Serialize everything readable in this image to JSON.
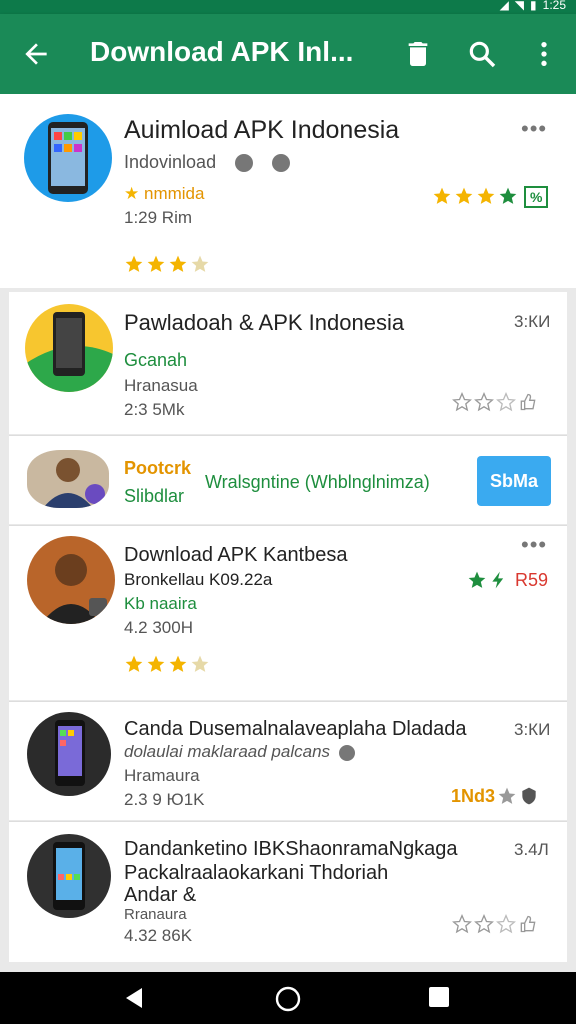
{
  "status": {
    "time": "1:25"
  },
  "appbar": {
    "title": "Download APK Inl..."
  },
  "items": [
    {
      "title": "Auimload APK Indonesia",
      "dev": "Indovinload",
      "line3": "nmmida",
      "line4": "1:29 Rim",
      "stars": 3,
      "badge": "%"
    },
    {
      "title": "Pawladoah & APK Indonesia",
      "line2": "Gcanah",
      "line3": "Hranasua",
      "line4": "2:3 5Mk",
      "right": "3:КИ"
    },
    {
      "title1": "Pootcrk",
      "title2": "Slibdlar",
      "middle": "Wralsgntine (Whblnglnimza)",
      "button": "SbMa"
    },
    {
      "title": "Download APK Kantbesa",
      "line2": "Bronkellau K09.22a",
      "line3": "Kb naaira",
      "line4": "4.2 300H",
      "stars": 3,
      "right": "R59"
    },
    {
      "title": "Canda Dusemalnalaveaplaha Dladada",
      "line2": "dolaulai maklaraad palcans",
      "line3": "Hramaura",
      "line4": "2.3 9 Ю1K",
      "right": "3:КИ",
      "rating": "1Nd3"
    },
    {
      "title1": "Dandanketino IBKShaonramaNgkaga",
      "title2": "Packalraalaokarkani Thdoriah",
      "title3": "Andar &",
      "line3": "Rranaura",
      "line4": "4.32 86K",
      "right": "3.4Л"
    }
  ],
  "colors": {
    "appbar": "#1a8a57",
    "button": "#3aaaf0",
    "star": "#f4b400"
  }
}
